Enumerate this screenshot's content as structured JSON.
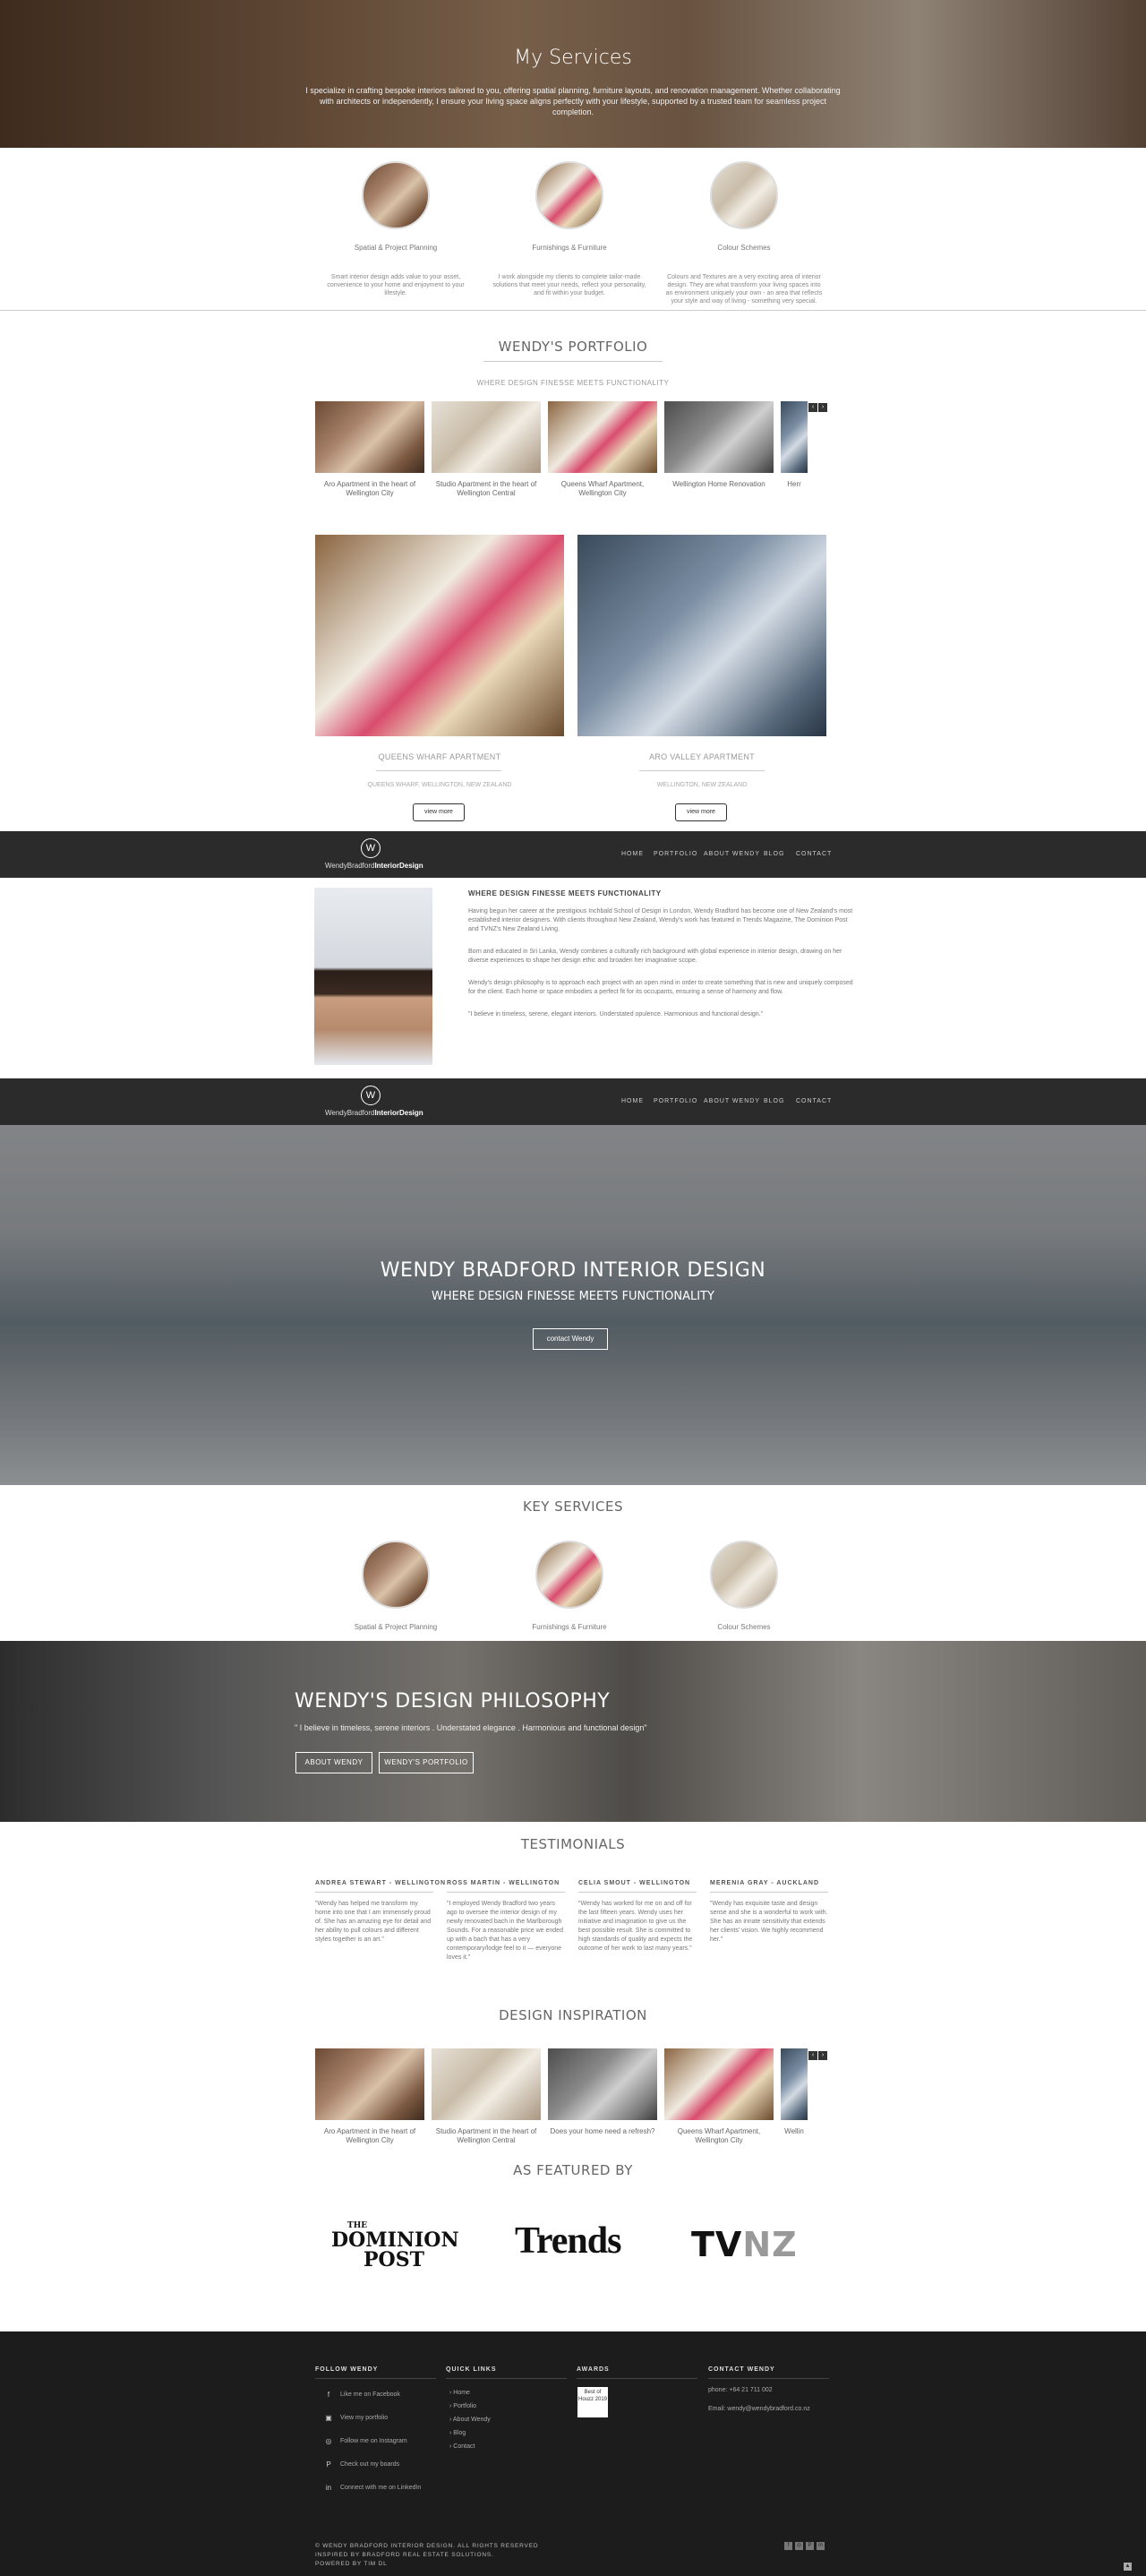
{
  "services_section": {
    "title": "My Services",
    "description": "I specialize in crafting bespoke interiors tailored to you, offering spatial planning, furniture layouts, and renovation management. Whether collaborating with architects or independently, I ensure your living space aligns perfectly with your lifestyle, supported by a trusted team for seamless project completion.",
    "items": [
      {
        "label": "Spatial & Project Planning",
        "desc": "Smart interior design adds value to your asset, convenience to your home and enjoyment to your lifestyle."
      },
      {
        "label": "Furnishings & Furniture",
        "desc": "I work alongside my clients to complete tailor-made solutions that meet your needs, reflect your personality, and fit within your budget."
      },
      {
        "label": "Colour Schemes",
        "desc": "Colours and Textures are a very exciting area of interior design. They are what transform your living spaces into an environment uniquely your own - an area that reflects your style and way of living - something very special."
      }
    ]
  },
  "portfolio": {
    "title": "WENDY'S PORTFOLIO",
    "subtitle": "WHERE DESIGN FINESSE MEETS FUNCTIONALITY",
    "carousel": [
      "Aro Apartment in the heart of Wellington City",
      "Studio Apartment in the heart of Wellington Central",
      "Queens Wharf Apartment, Wellington City",
      "Wellington Home Renovation",
      "Herr"
    ],
    "projects": [
      {
        "title": "QUEENS WHARF APARTMENT",
        "location": "QUEENS WHARF, WELLINGTON, NEW ZEALAND",
        "button": "view more"
      },
      {
        "title": "ARO VALLEY APARTMENT",
        "location": "WELLINGTON, NEW ZEALAND",
        "button": "view more"
      }
    ]
  },
  "nav": {
    "logo_mark": "W",
    "logo_light": "WendyBradford",
    "logo_bold": "InteriorDesign",
    "links": [
      "HOME",
      "PORTFOLIO",
      "ABOUT WENDY",
      "BLOG",
      "CONTACT"
    ]
  },
  "about": {
    "heading": "WHERE DESIGN FINESSE MEETS FUNCTIONALITY",
    "paragraphs": [
      "Having begun her career at the prestigious Inchbald School of Design in London, Wendy Bradford has become one of New Zealand's most established interior designers. With clients throughout New Zealand, Wendy's work has featured in Trends Magazine, The Dominion Post and TVNZ's New Zealand Living.",
      "Born and educated in Sri Lanka, Wendy combines a culturally rich background with global experience in interior design, drawing on her diverse experiences to shape her design ethic and broaden her imaginative scope.",
      "Wendy's design philosophy is to approach each project with an open mind in order to create something that is new and uniquely composed for the client. Each home or space embodies a perfect fit for its occupants, ensuring a sense of harmony and flow.",
      "\"I believe in timeless, serene, elegant interiors. Understated opulence. Harmonious and functional design.\""
    ]
  },
  "hero": {
    "title": "WENDY BRADFORD INTERIOR DESIGN",
    "subtitle": "WHERE DESIGN FINESSE MEETS FUNCTIONALITY",
    "button": "contact Wendy"
  },
  "key_services": {
    "title": "KEY SERVICES",
    "items": [
      "Spatial & Project Planning",
      "Furnishings & Furniture",
      "Colour Schemes"
    ]
  },
  "philosophy": {
    "title": "WENDY'S DESIGN PHILOSOPHY",
    "quote": "\" I believe in timeless, serene interiors . Understated elegance . Harmonious and functional design\"",
    "btn_about": "ABOUT WENDY",
    "btn_portfolio": "WENDY'S PORTFOLIO"
  },
  "testimonials": {
    "title": "TESTIMONIALS",
    "items": [
      {
        "name": "ANDREA STEWART - WELLINGTON",
        "text": "\"Wendy has helped me transform my home into one that I am immensely proud of. She has an amazing eye for detail and her ability to pull colours and different styles together is an art.\""
      },
      {
        "name": "ROSS MARTIN - WELLINGTON",
        "text": "\"I employed Wendy Bradford two years ago to oversee the interior design of my newly renovated bach in the Marlborough Sounds. For a reasonable price we ended up with a bach that has a very contemporary/lodge feel to it — everyone loves it.\""
      },
      {
        "name": "CELIA SMOUT - WELLINGTON",
        "text": "\"Wendy has worked for me on and off for the last fifteen years. Wendy uses her initiative and imagination to give us the best possible result. She is committed to high standards of quality and expects the outcome of her work to last many years.\""
      },
      {
        "name": "MERENIA GRAY - AUCKLAND",
        "text": "\"Wendy has exquisite taste and design sense and she is a wonderful to work with. She has an innate sensitivity that extends her clients' vision. We highly recommend her.\""
      }
    ]
  },
  "inspiration": {
    "title": "DESIGN INSPIRATION",
    "carousel": [
      "Aro Apartment in the heart of Wellington City",
      "Studio Apartment in the heart of Wellington Central",
      "Does your home need a refresh?",
      "Queens Wharf Apartment, Wellington City",
      "Wellin"
    ]
  },
  "featured": {
    "title": "AS FEATURED BY",
    "dominion_line1": "THE",
    "dominion_line2": "DOMINION",
    "dominion_line3": "POST",
    "trends": "Trends",
    "tvnz_tv": "TV",
    "tvnz_nz": "NZ"
  },
  "footer": {
    "follow_title": "FOLLOW WENDY",
    "follow_items": [
      {
        "icon": "facebook-icon",
        "label": "Like me on Facebook"
      },
      {
        "icon": "portfolio-icon",
        "label": "View my portfolio"
      },
      {
        "icon": "instagram-icon",
        "label": "Follow me on Instagram"
      },
      {
        "icon": "pinterest-icon",
        "label": "Check out my boards"
      },
      {
        "icon": "linkedin-icon",
        "label": "Connect with me on LinkedIn"
      }
    ],
    "links_title": "QUICK LINKS",
    "links": [
      "Home",
      "Portfolio",
      "About Wendy",
      "Blog",
      "Contact"
    ],
    "awards_title": "AWARDS",
    "award_text": "Best of Houzz 2019",
    "contact_title": "CONTACT WENDY",
    "phone": "phone: +64 21 711 002",
    "email": "Email: wendy@wendybradford.co.nz",
    "copyright": "© WENDY BRADFORD INTERIOR DESIGN. ALL RIGHTS RESERVED",
    "inspired": "INSPIRED BY BRADFORD REAL ESTATE SOLUTIONS.",
    "powered": "POWERED BY TIM DL"
  },
  "colors": {
    "nav_bg": "#2b2b2b",
    "footer_bg": "#1c1c1c",
    "text": "#555555"
  }
}
